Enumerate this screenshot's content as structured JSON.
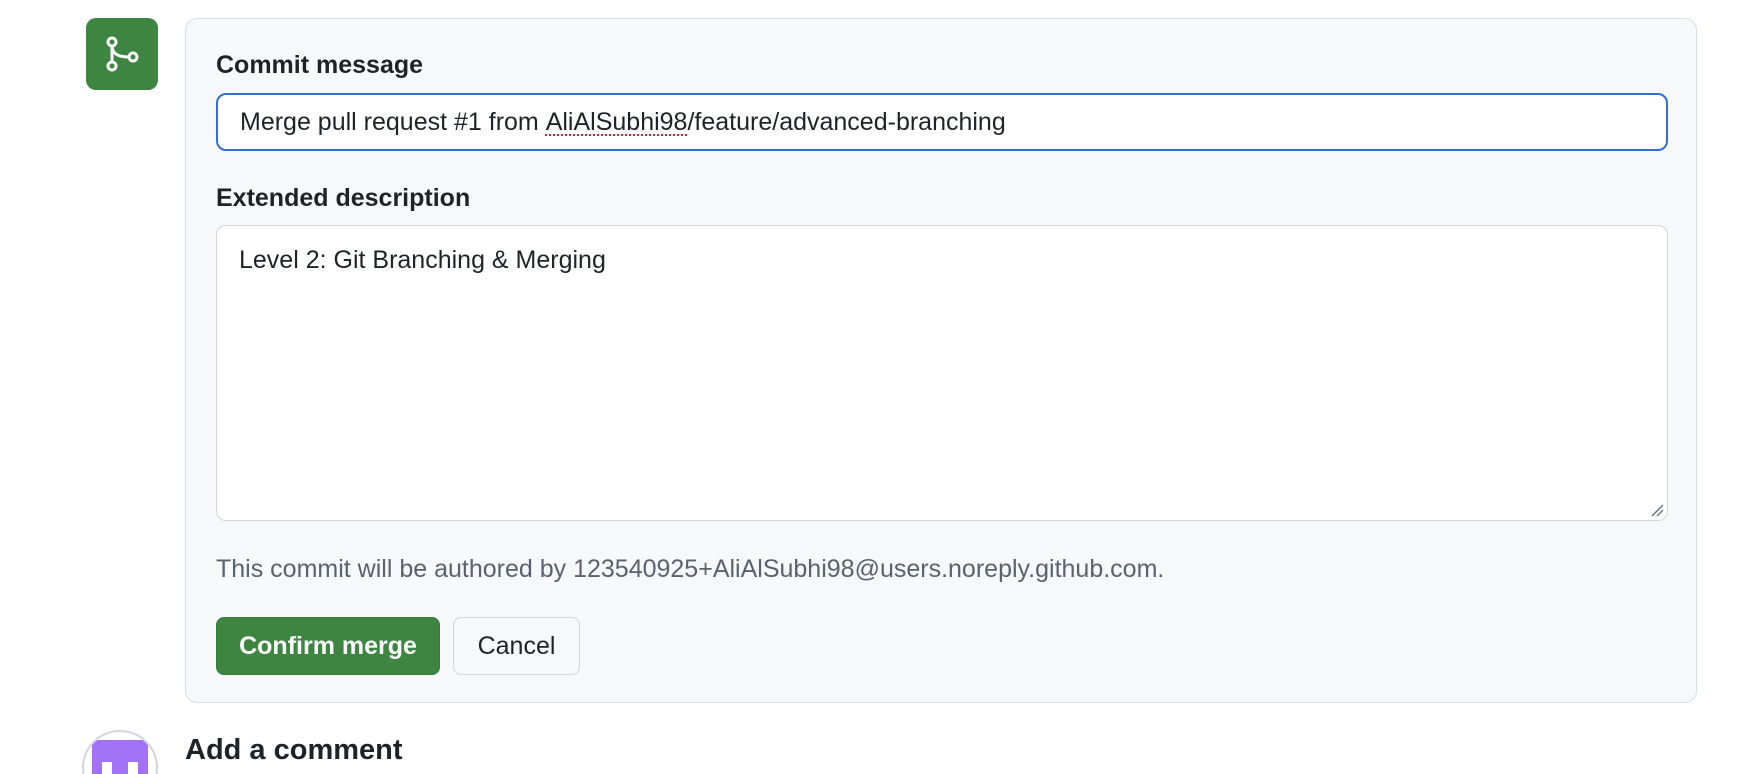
{
  "merge_form": {
    "commit_message_label": "Commit message",
    "commit_message_value_prefix": "Merge pull request #1 from ",
    "commit_message_value_flagged": "AliAlSubhi98",
    "commit_message_value_suffix": "/feature/advanced-branching",
    "extended_description_label": "Extended description",
    "extended_description_value": "Level 2: Git Branching & Merging",
    "author_note": "This commit will be authored by 123540925+AliAlSubhi98@users.noreply.github.com.",
    "confirm_label": "Confirm merge",
    "cancel_label": "Cancel"
  },
  "comment": {
    "title": "Add a comment"
  },
  "icons": {
    "merge_badge": "git-merge-icon",
    "resize_grip": "resize-grip-icon"
  },
  "colors": {
    "merge_green": "#3d8541",
    "input_focus_border": "#2f6fd6",
    "panel_background": "#f6f8fa",
    "muted_text": "#59636e",
    "avatar_purple": "#a371f7"
  }
}
